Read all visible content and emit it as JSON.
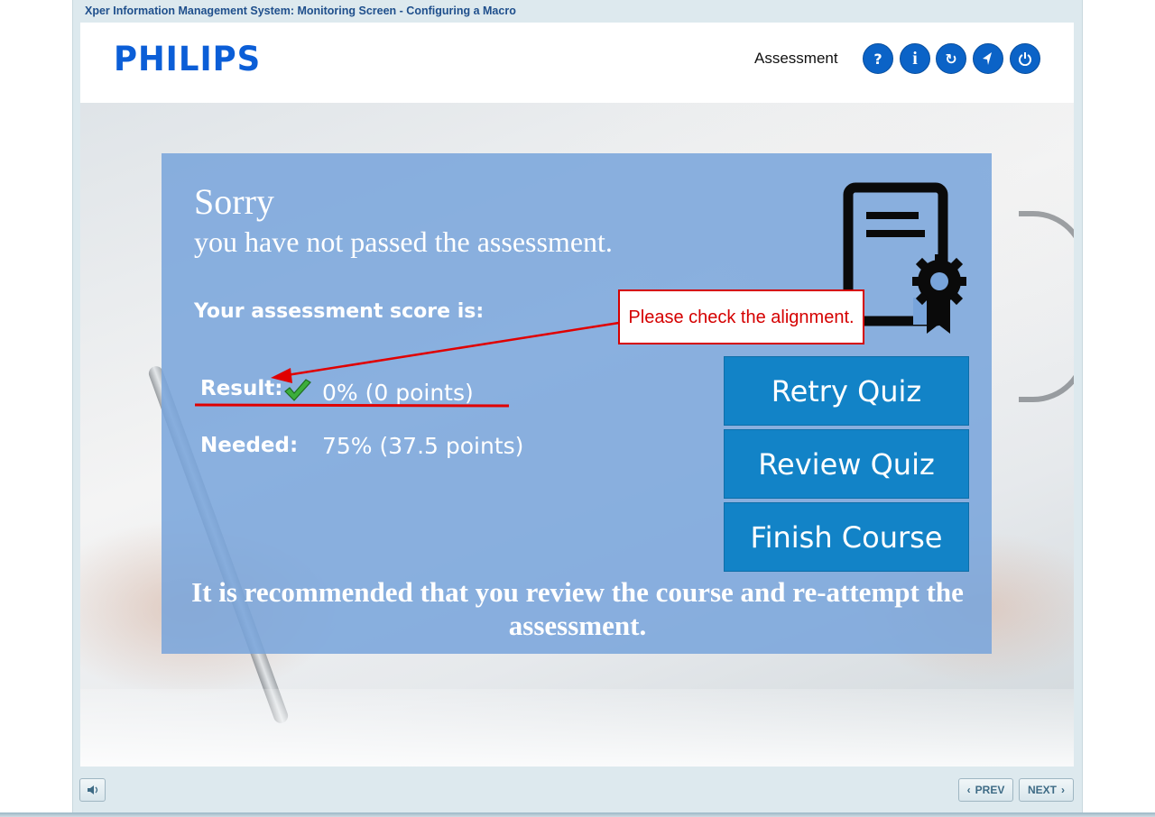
{
  "window": {
    "title": "Xper Information Management System: Monitoring Screen - Configuring a Macro"
  },
  "header": {
    "logo": "PHILIPS",
    "section_title": "Assessment",
    "buttons": [
      {
        "icon": "help-icon",
        "glyph": "?"
      },
      {
        "icon": "info-icon",
        "glyph": "i"
      },
      {
        "icon": "restart-icon",
        "glyph": "↻"
      },
      {
        "icon": "compass-icon",
        "glyph": "⊘"
      },
      {
        "icon": "power-icon",
        "glyph": "⏻"
      }
    ]
  },
  "result": {
    "heading": "Sorry",
    "subheading": "you have not passed the assessment.",
    "score_label": "Your assessment score is:",
    "result_label": "Result:",
    "result_value": "0% (0 points)",
    "needed_label": "Needed:",
    "needed_value": "75% (37.5 points)",
    "recommendation": "It is recommended that you review the course and re-attempt the assessment.",
    "actions": {
      "retry": "Retry Quiz",
      "review": "Review Quiz",
      "finish": "Finish Course"
    }
  },
  "annotation": {
    "text": "Please check the alignment.",
    "color": "#d50000"
  },
  "footer": {
    "audio_icon": "speaker-icon",
    "prev": "PREV",
    "next": "NEXT"
  },
  "colors": {
    "brand": "#0b5ed7",
    "panel": "#78a4db",
    "action_button": "#1283c7",
    "title_text": "#1f4f8c"
  }
}
